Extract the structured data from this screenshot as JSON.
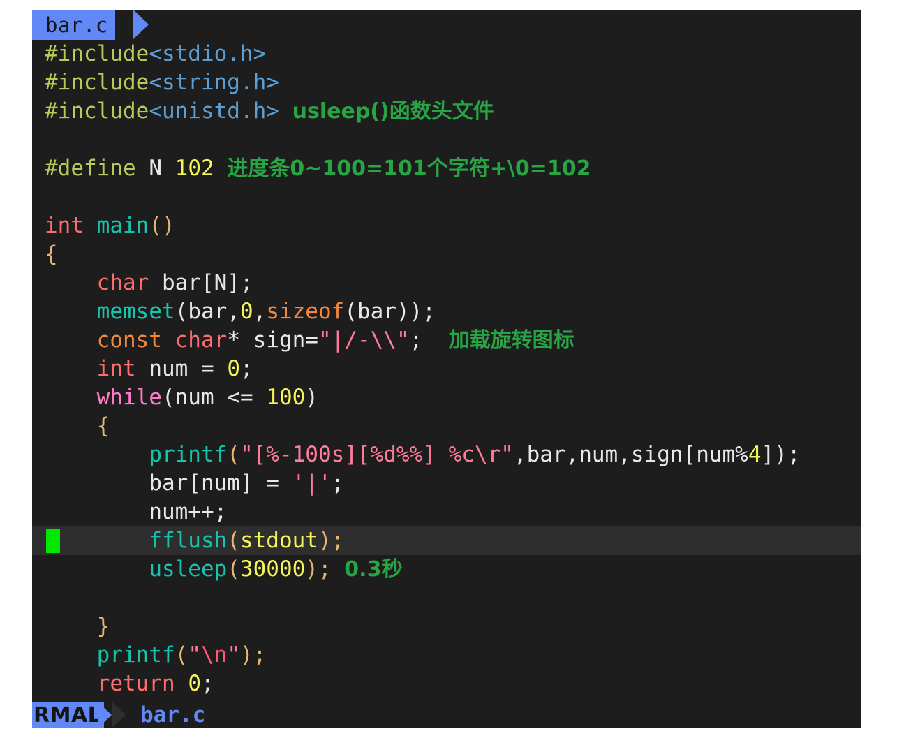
{
  "editor": {
    "tab": {
      "label": "bar.c"
    },
    "statusline": {
      "mode": "RMAL",
      "filename": "bar.c"
    },
    "colors": {
      "background": "#1d1d1d",
      "tab_bg": "#6188f5",
      "cursorline_bg": "#2e2e2e",
      "cursor_block": "#00e800",
      "annotation_green": "#27a544",
      "preprocessor": "#b5cc5a",
      "header": "#5b9fd4",
      "keyword": "#fc6e6e",
      "function": "#17c3ac",
      "number": "#f5f55a",
      "string": "#ff7b9c",
      "modifier": "#f0883e"
    },
    "code": {
      "l1": {
        "pp": "#include",
        "hdr": "<stdio.h>"
      },
      "l2": {
        "pp": "#include",
        "hdr": "<string.h>"
      },
      "l3": {
        "pp": "#include",
        "hdr": "<unistd.h>",
        "note": "usleep()函数头文件"
      },
      "l5": {
        "pp": "#define",
        "name": " N ",
        "num": "102",
        "note": "进度条0~100=101个字符+\\0=102"
      },
      "l7": {
        "kw": "int",
        "fn": "main",
        "paren": "()"
      },
      "l8": {
        "brace": "{"
      },
      "l9": {
        "kw": "char",
        "rest": " bar[N];"
      },
      "l10": {
        "fn": "memset",
        "p1": "(bar,",
        "num": "0",
        "p2": ",",
        "mod": "sizeof",
        "p3": "(bar));"
      },
      "l11": {
        "mod": "const",
        "kw": " char",
        "star": "* sign=",
        "str": "\"|/-\\\\\"",
        "semi": ";",
        "note": "加载旋转图标"
      },
      "l12": {
        "kw": "int",
        "mid": " num = ",
        "num": "0",
        "semi": ";"
      },
      "l13": {
        "kw2": "while",
        "mid": "(num <= ",
        "num": "100",
        "close": ")"
      },
      "l14": {
        "brace": "{"
      },
      "l15": {
        "fn": "printf",
        "p1": "(",
        "str": "\"[%-100s][%d%%] %c\\r\"",
        "p2": ",bar,num,sign[num%",
        "num": "4",
        "p3": "]);"
      },
      "l16": {
        "pre": "bar[num] = ",
        "str": "'|'",
        "semi": ";"
      },
      "l17": {
        "text": "num++;"
      },
      "l18": {
        "fn": "fflush",
        "p1": "(",
        "arg": "stdout",
        "p2": ");",
        "cursor": true
      },
      "l19": {
        "fn": "usleep",
        "p1": "(",
        "num": "30000",
        "p2": ");",
        "note": "0.3秒"
      },
      "l21": {
        "brace": "}"
      },
      "l22": {
        "fn": "printf",
        "p1": "(",
        "str": "\"",
        "esc": "\\n",
        "str2": "\"",
        "p2": ");"
      },
      "l23": {
        "kw": "return",
        "sp": " ",
        "num": "0",
        "semi": ";"
      }
    }
  }
}
